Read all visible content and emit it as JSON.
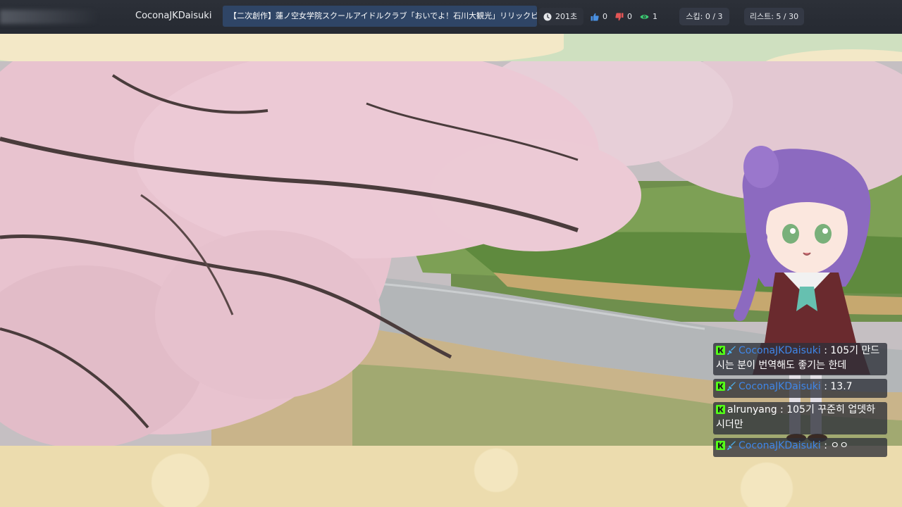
{
  "header": {
    "channel_name": "CoconaJKDaisuki",
    "video_title": "【二次創作】蓮ノ空女学院スクールアイドルクラブ「おいでよ！石川大観光」リリックビデオ",
    "duration": "201초",
    "likes": "0",
    "dislikes": "0",
    "viewers": "1",
    "skip_label": "스킵: 0 / 3",
    "list_label": "리스트: 5 / 30"
  },
  "colors": {
    "like_icon": "#4a90e2",
    "dislike_icon": "#e25555",
    "viewer_icon": "#3ccf74",
    "kick_badge": "#53fc18",
    "username_blue": "#3f86e8"
  },
  "chat": {
    "messages": [
      {
        "user": "CoconaJKDaisuki",
        "text": " : 105기 만드시는 분이 번역해도 좋기는 한데",
        "badges": [
          "kick-icon",
          "sword-icon"
        ]
      },
      {
        "user": "CoconaJKDaisuki",
        "text": " : 13.7",
        "badges": [
          "kick-icon",
          "sword-icon"
        ]
      },
      {
        "user": "alrunyang",
        "text": " : 105기 꾸준히 업뎃하시더만",
        "badges": [
          "kick-icon"
        ]
      },
      {
        "user": "CoconaJKDaisuki",
        "text": " : ㅇㅇ",
        "badges": [
          "kick-icon",
          "sword-icon"
        ]
      }
    ]
  }
}
